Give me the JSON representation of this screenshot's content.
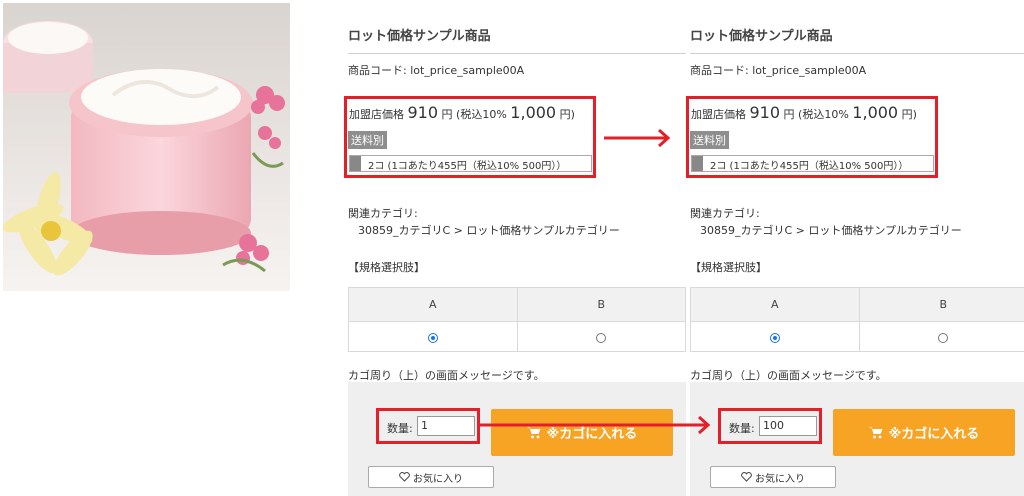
{
  "left_panel": {
    "title": "ロット価格サンプル商品",
    "code": "商品コード: lot_price_sample00A",
    "price": {
      "label": "加盟店価格",
      "value": "910",
      "unit": "円",
      "tax_open": "(税込10%",
      "tax_value": "1,000",
      "tax_close": "円)"
    },
    "shipping": "送料別",
    "lot": "2コ (1コあたり455円（税込10% 500円））",
    "category_label": "関連カテゴリ:",
    "category_value": "30859_カテゴリC > ロット価格サンプルカテゴリー",
    "spec_label": "【規格選択肢】",
    "spec_headers": [
      "A",
      "B"
    ],
    "selected_option": "A",
    "cart_message": "カゴ周り（上）の画面メッセージです。",
    "qty_label": "数量:",
    "qty_value": "1",
    "cart_button": "※カゴに入れる",
    "favorite_button": "お気に入り"
  },
  "right_panel": {
    "title": "ロット価格サンプル商品",
    "code": "商品コード: lot_price_sample00A",
    "price": {
      "label": "加盟店価格",
      "value": "910",
      "unit": "円",
      "tax_open": "(税込10%",
      "tax_value": "1,000",
      "tax_close": "円)"
    },
    "shipping": "送料別",
    "lot": "2コ (1コあたり455円（税込10% 500円））",
    "category_label": "関連カテゴリ:",
    "category_value": "30859_カテゴリC > ロット価格サンプルカテゴリー",
    "spec_label": "【規格選択肢】",
    "spec_headers": [
      "A",
      "B"
    ],
    "selected_option": "A",
    "cart_message": "カゴ周り（上）の画面メッセージです。",
    "qty_label": "数量:",
    "qty_value": "100",
    "cart_button": "※カゴに入れる",
    "favorite_button": "お気に入り"
  },
  "colors": {
    "highlight": "#e41f2a",
    "cart_button": "#f7a425",
    "radio_selected": "#1a73e8",
    "badge": "#8e8e8e"
  },
  "icons": {
    "cart": "cart-icon",
    "favorite": "heart-icon",
    "arrow": "right-arrow-icon"
  }
}
